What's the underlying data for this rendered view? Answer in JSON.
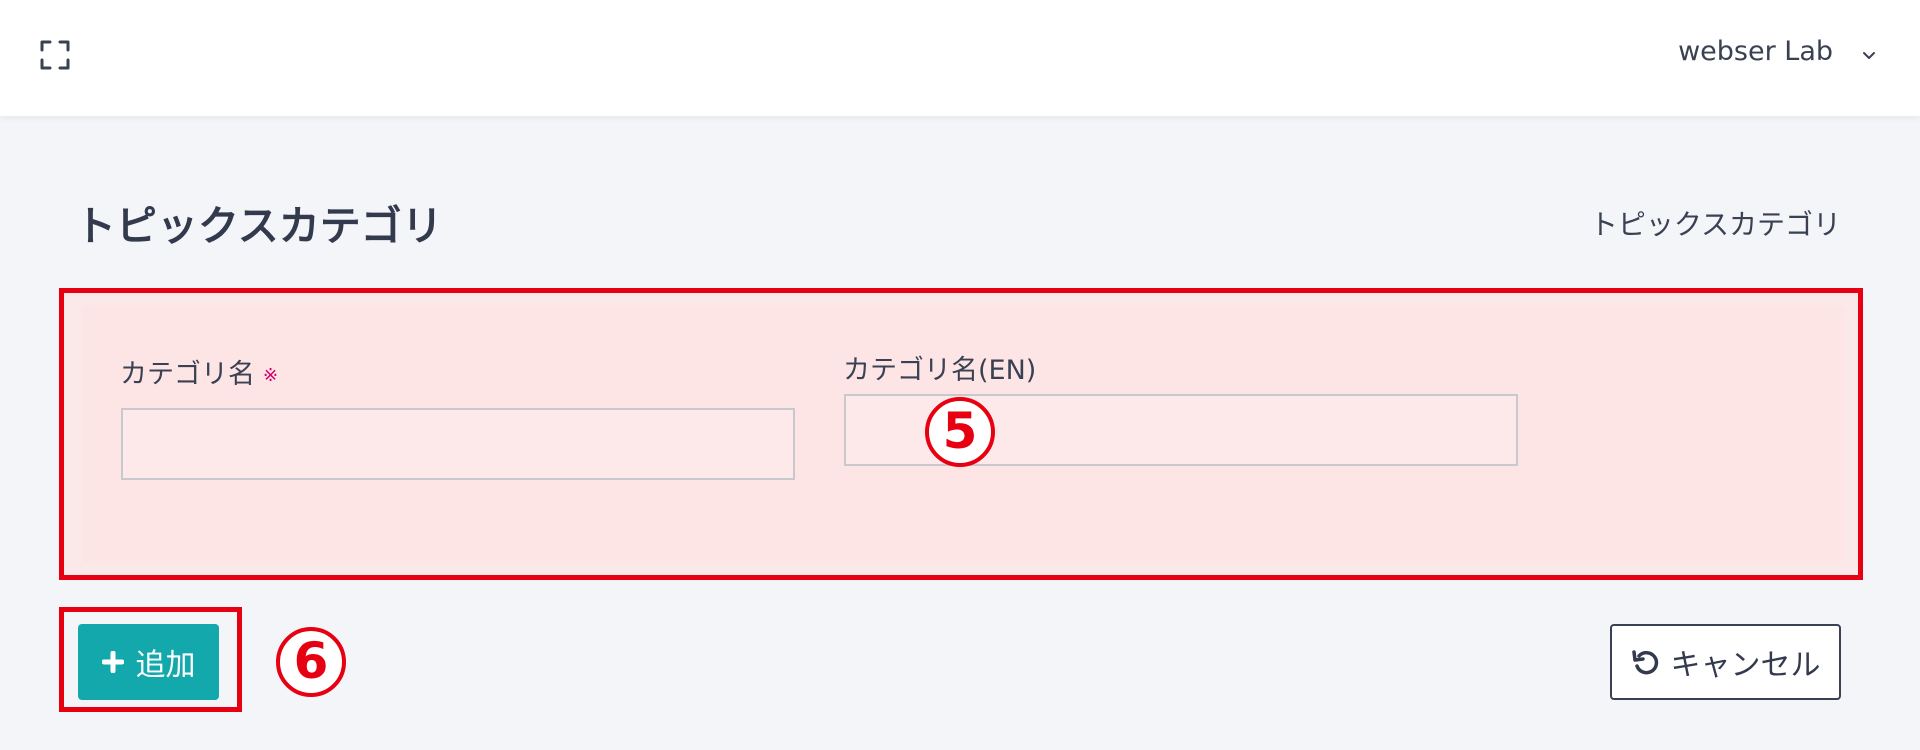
{
  "header": {
    "user_name": "webser Lab"
  },
  "page": {
    "title": "トピックスカテゴリ",
    "breadcrumb": "トピックスカテゴリ"
  },
  "form": {
    "fields": [
      {
        "label": "カテゴリ名",
        "required_mark": "※",
        "value": "",
        "placeholder": ""
      },
      {
        "label": "カテゴリ名(EN)",
        "value": "",
        "placeholder": ""
      }
    ]
  },
  "annotations": {
    "form_callout": "5",
    "add_callout": "6",
    "highlight_color": "#e60012"
  },
  "actions": {
    "add_label": "追加",
    "cancel_label": "キャンセル"
  },
  "colors": {
    "primary": "#13a9ac",
    "text": "#333a4d",
    "required": "#d6006c",
    "background": "#f4f5f9"
  },
  "icons": {
    "expand": "expand-icon",
    "chevron": "chevron-down-icon",
    "plus": "plus-icon",
    "undo": "undo-icon"
  }
}
